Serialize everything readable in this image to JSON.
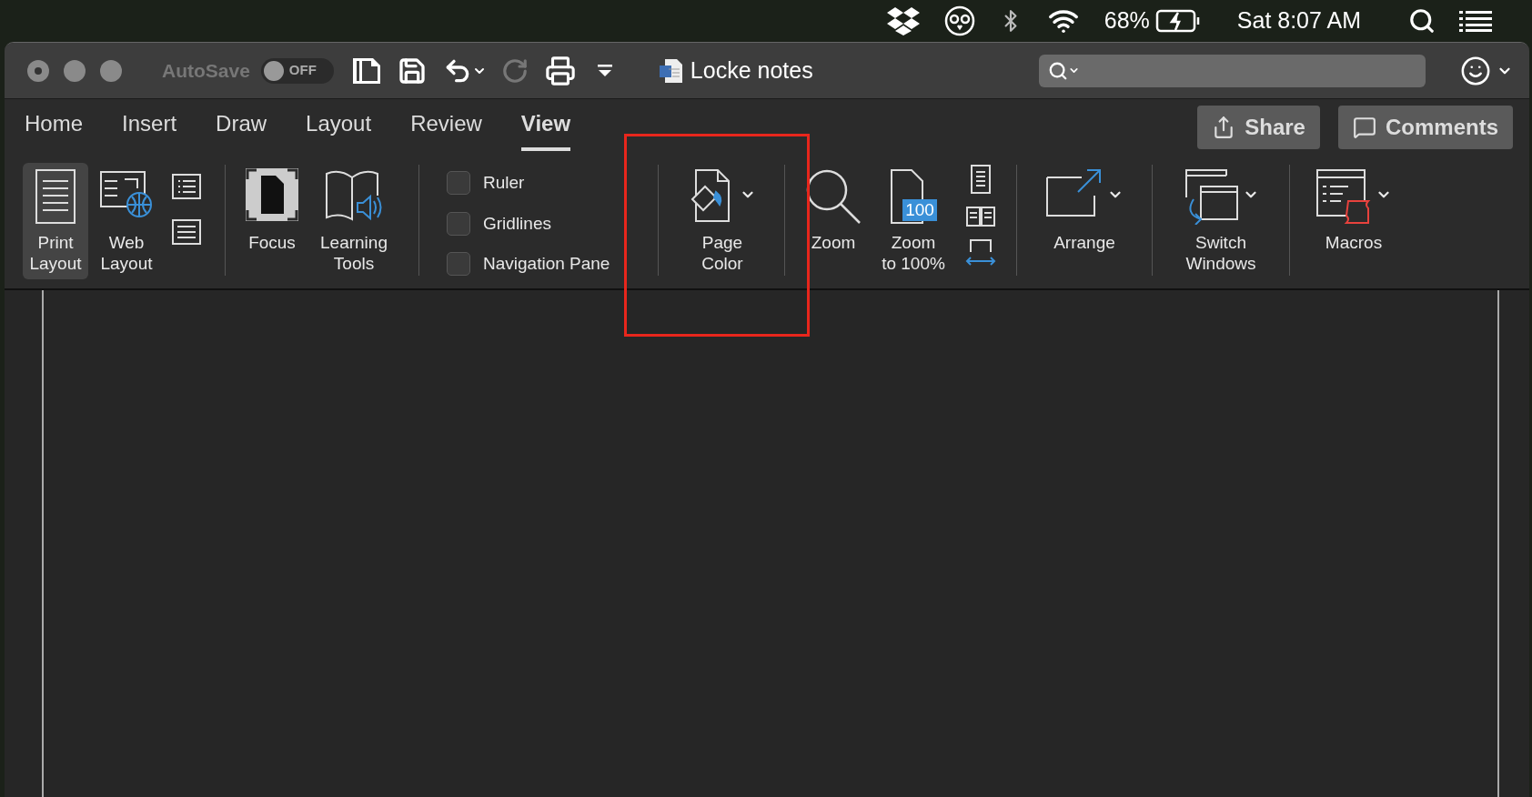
{
  "menu_bar": {
    "battery": "68%",
    "clock": "Sat 8:07 AM"
  },
  "title_bar": {
    "autosave": {
      "label": "AutoSave",
      "state": "OFF",
      "on": false
    },
    "title": "Locke notes"
  },
  "tabs": [
    {
      "label": "Home",
      "selected": false
    },
    {
      "label": "Insert",
      "selected": false
    },
    {
      "label": "Draw",
      "selected": false
    },
    {
      "label": "Layout",
      "selected": false
    },
    {
      "label": "Review",
      "selected": false
    },
    {
      "label": "View",
      "selected": true
    }
  ],
  "buttons": [
    "Share",
    "Comments"
  ],
  "ribbon": {
    "views": [
      {
        "label": "Print\nLayout",
        "selected": true
      },
      {
        "label": "Web\nLayout",
        "selected": false
      }
    ],
    "immersive": [
      "Focus",
      "Learning\nTools"
    ],
    "show": [
      {
        "label": "Ruler",
        "checked": false
      },
      {
        "label": "Gridlines",
        "checked": false
      },
      {
        "label": "Navigation Pane",
        "checked": false
      }
    ],
    "page_color": "Page\nColor",
    "zoom": [
      "Zoom",
      "Zoom\nto 100%"
    ],
    "zoom_badge": "100",
    "arrange": "Arrange",
    "switch_windows": "Switch\nWindows",
    "macros": "Macros"
  }
}
